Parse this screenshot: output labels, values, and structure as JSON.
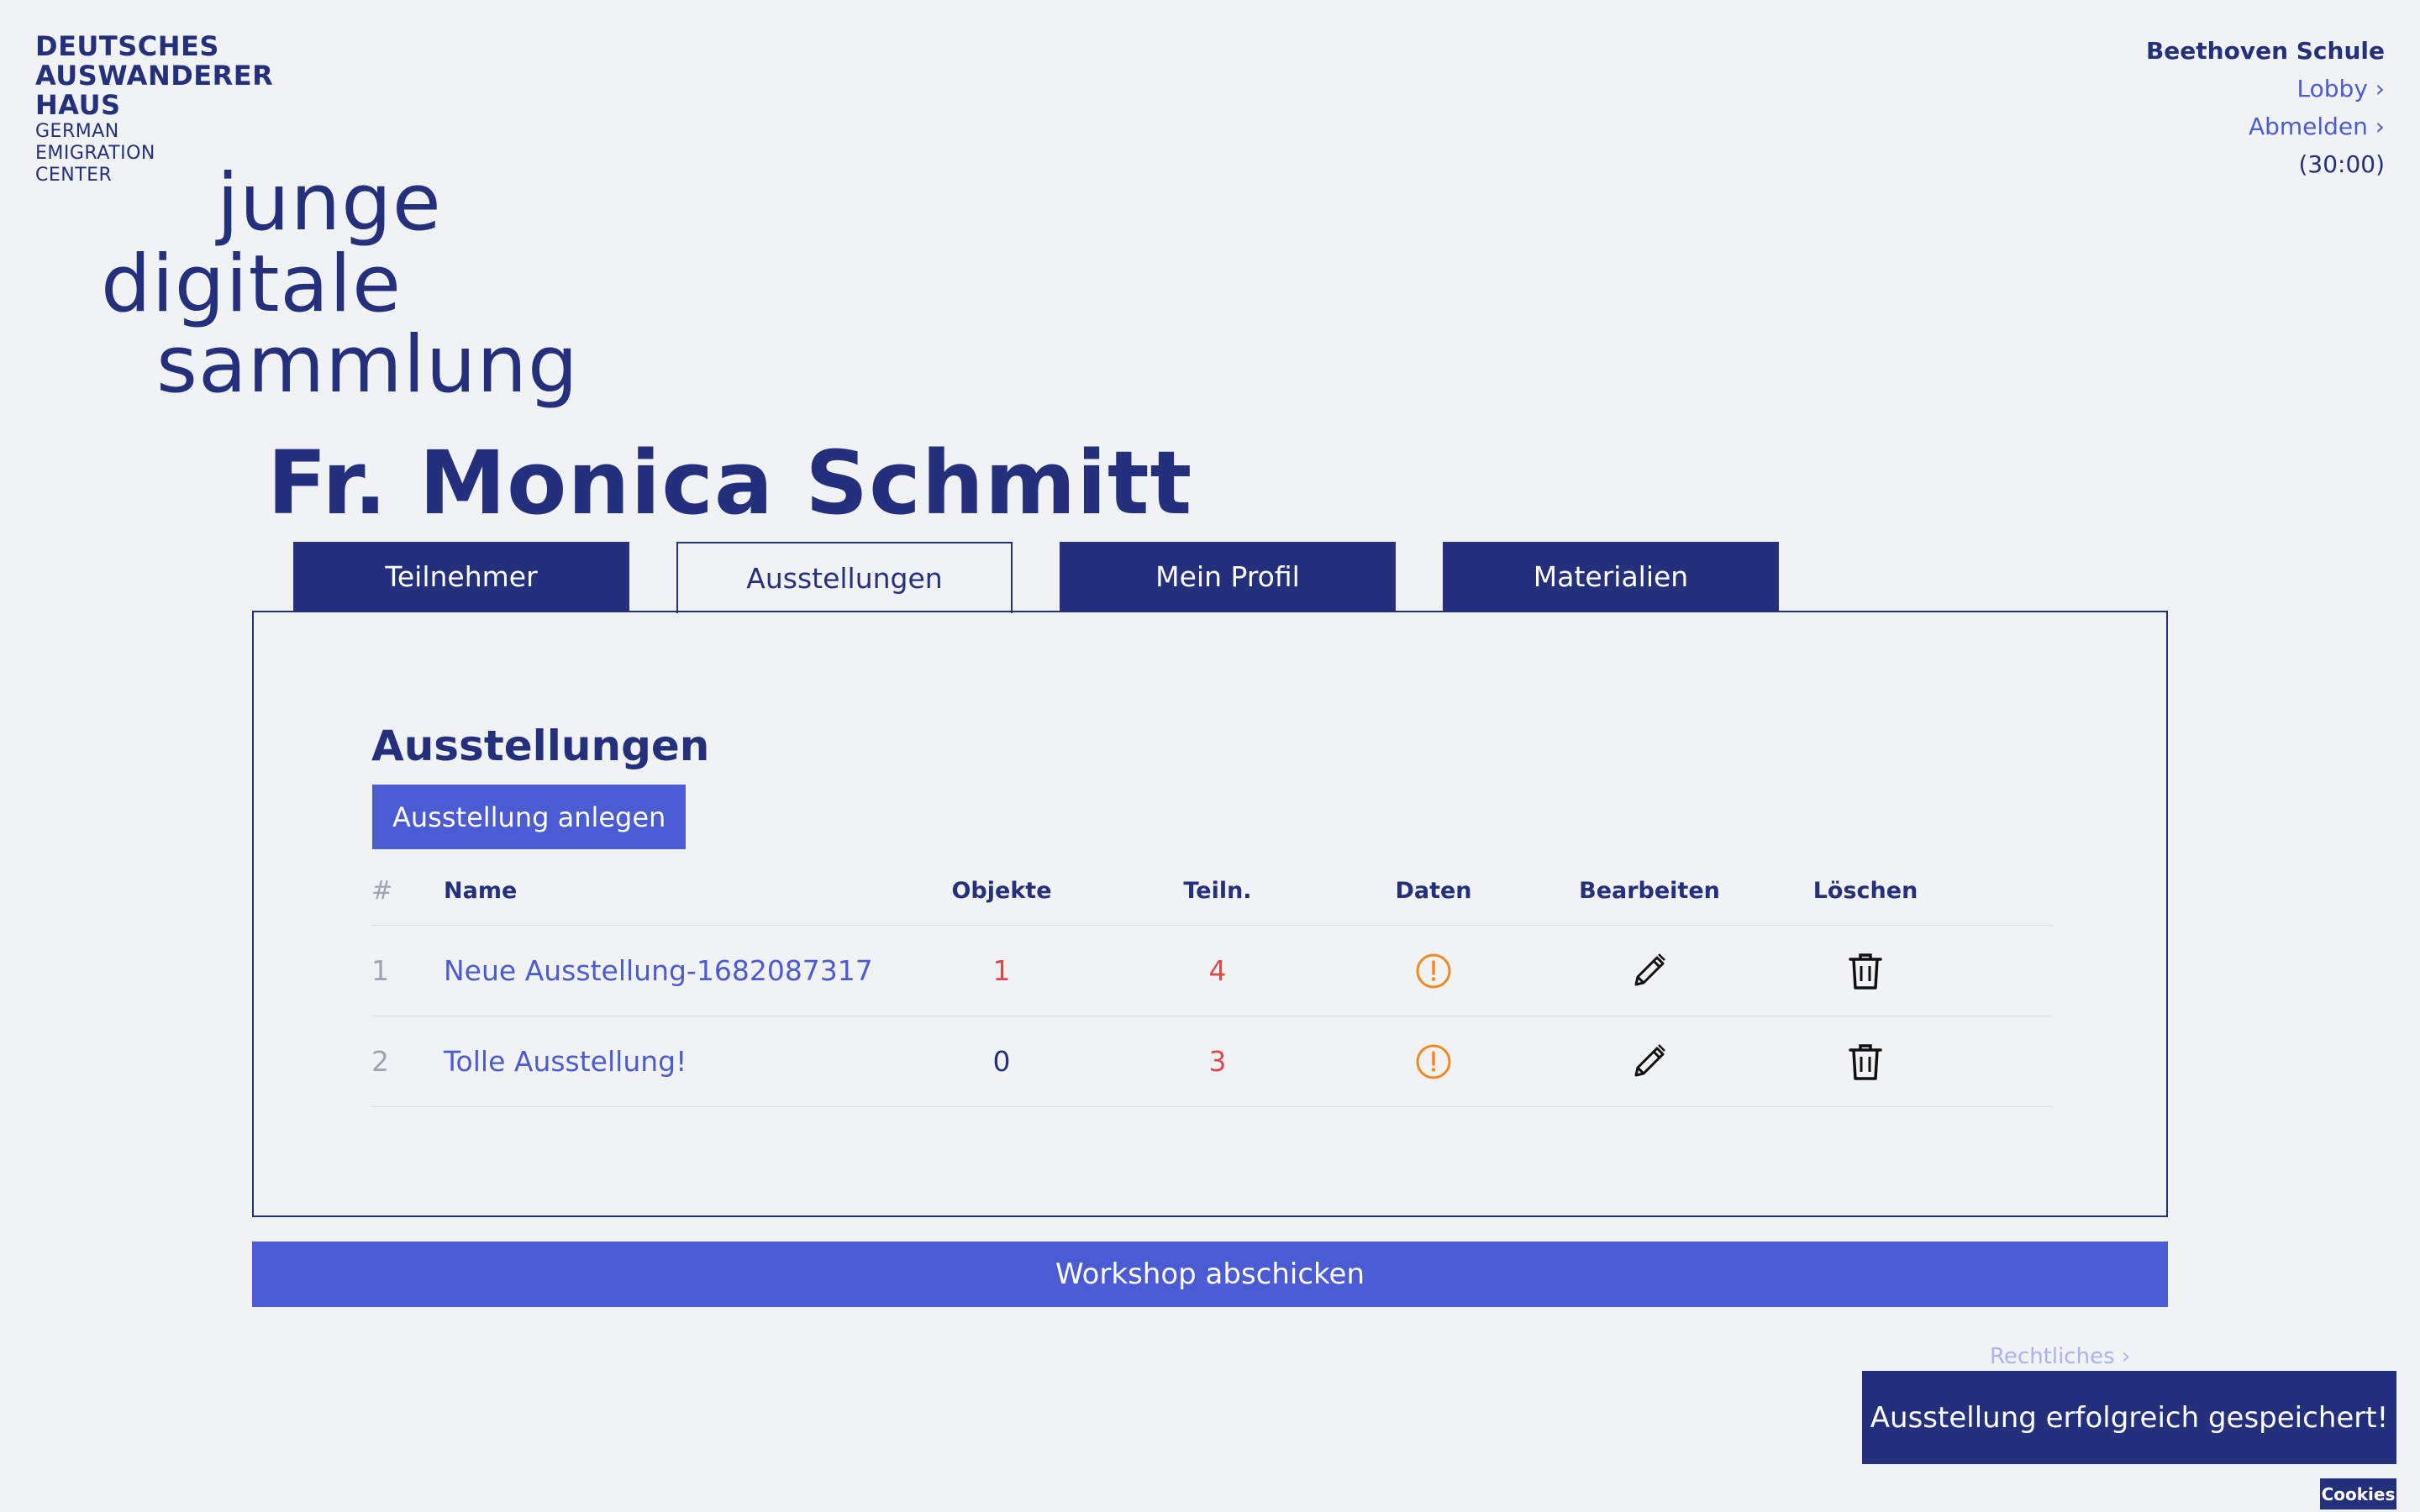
{
  "brand": {
    "line1": "DEUTSCHES",
    "line2": "AUSWANDERER",
    "line3": "HAUS",
    "sub1": "GERMAN",
    "sub2": "EMIGRATION",
    "sub3": "CENTER"
  },
  "logo": {
    "word1": "junge",
    "word2": "digitale",
    "word3": "sammlung"
  },
  "user": {
    "school": "Beethoven Schule",
    "lobby": "Lobby ›",
    "logout": "Abmelden ›",
    "timer": "(30:00)"
  },
  "teacher_name": "Fr. Monica Schmitt",
  "tabs": [
    {
      "label": "Teilnehmer"
    },
    {
      "label": "Ausstellungen"
    },
    {
      "label": "Mein Profil"
    },
    {
      "label": "Materialien"
    }
  ],
  "active_tab": "Ausstellungen",
  "panel": {
    "heading": "Ausstellungen",
    "create_button": "Ausstellung anlegen",
    "columns": {
      "hash": "#",
      "name": "Name",
      "objects": "Objekte",
      "participants": "Teiln.",
      "data": "Daten",
      "edit": "Bearbeiten",
      "delete": "Löschen"
    },
    "rows": [
      {
        "index": "1",
        "name": "Neue Ausstellung-1682087317",
        "objects": "1",
        "participants": "4"
      },
      {
        "index": "2",
        "name": "Tolle Ausstellung!",
        "objects": "0",
        "participants": "3"
      }
    ]
  },
  "submit_button": "Workshop abschicken",
  "legal_link": "Rechtliches ›",
  "toast": "Ausstellung erfolgreich gespeichert!",
  "cookies_button": "Cookies",
  "icons": {
    "data": "alert-circle-icon",
    "edit": "pencil-icon",
    "delete": "trash-icon"
  },
  "colors": {
    "primary": "#25307c",
    "accent": "#4b5bd4",
    "warning": "#f08a24",
    "alert_number": "#e0484e",
    "background": "#f1f2f4"
  }
}
